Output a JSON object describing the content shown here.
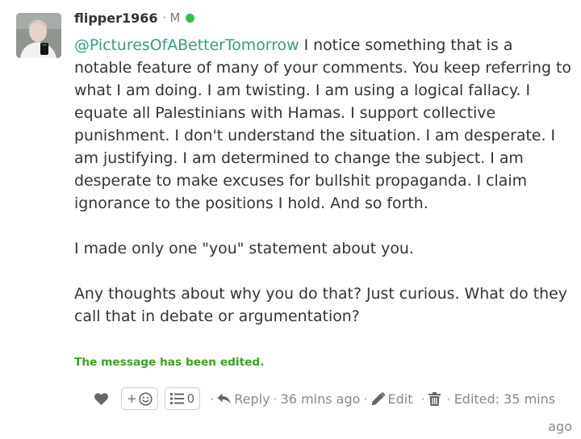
{
  "comment": {
    "author": "flipper1966",
    "separator": "·",
    "user_flag": "M",
    "online_color": "#2fc248",
    "avatar_icon": "user-photo",
    "mention": "@PicturesOfABetterTomorrow",
    "paragraph_1_rest": " I notice something that is a notable feature of many of your comments. You keep referring to what I am doing. I am twisting. I am using a logical fallacy. I equate all Palestinians with Hamas. I support collective punishment. I don't understand the situation. I am desperate. I am justifying. I am determined to change the subject. I am desperate to make excuses for bullshit propaganda. I claim ignorance to the positions I hold. And so forth.",
    "paragraph_2": "I made only one \"you\" statement about you.",
    "paragraph_3": "Any thoughts about why you do that? Just curious. What do they call that in debate or argumentation?",
    "edited_note": "The message has been edited."
  },
  "actions": {
    "like_icon": "heart-icon",
    "add_reaction_plus": "+",
    "add_reaction_icon": "smiley-icon",
    "list_icon": "list-icon",
    "list_count": "0",
    "dot": "·",
    "reply_label": "Reply",
    "time_ago": "36 mins ago",
    "edit_label": "Edit",
    "edited_prefix": "Edited: 35 mins",
    "edited_suffix": "ago",
    "accent_color": "#3b9b84",
    "edited_color": "#3ca21f"
  }
}
